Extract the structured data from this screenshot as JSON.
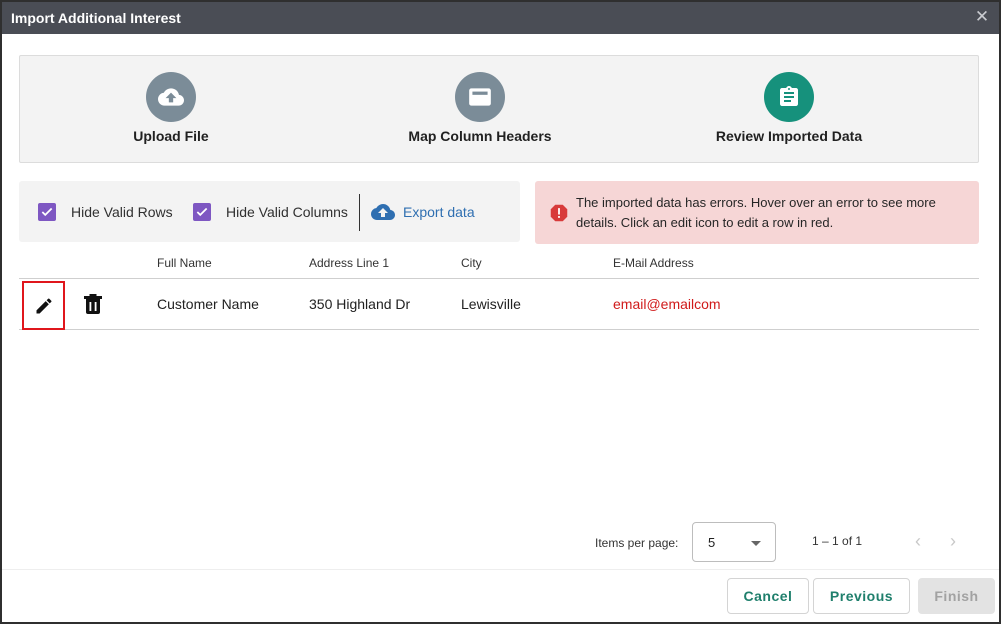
{
  "dialog": {
    "title": "Import Additional Interest",
    "close_glyph": "✕"
  },
  "stepper": {
    "steps": [
      {
        "label": "Upload File",
        "icon": "cloud-upload-icon",
        "state": "done"
      },
      {
        "label": "Map Column Headers",
        "icon": "column-headers-icon",
        "state": "done"
      },
      {
        "label": "Review Imported Data",
        "icon": "clipboard-icon",
        "state": "active"
      }
    ],
    "colors": {
      "done": "#7b8c98",
      "active": "#16917c"
    }
  },
  "toolbar": {
    "hide_valid_rows": {
      "label": "Hide Valid Rows",
      "checked": true
    },
    "hide_valid_columns": {
      "label": "Hide Valid Columns",
      "checked": true
    },
    "export_label": "Export data"
  },
  "alert": {
    "icon": "error-octagon-icon",
    "text": "The imported data has errors. Hover over an error to see more details. Click an edit icon to edit a row in red."
  },
  "table": {
    "columns": [
      "Full Name",
      "Address Line 1",
      "City",
      "E-Mail Address"
    ],
    "rows": [
      {
        "full_name": "Customer Name",
        "address_line_1": "350 Highland Dr",
        "city": "Lewisville",
        "email": "email@emailcom",
        "email_error": true
      }
    ]
  },
  "paginator": {
    "items_per_page_label": "Items per page:",
    "items_per_page": "5",
    "range": "1 – 1 of 1",
    "prev_glyph": "‹",
    "next_glyph": "›"
  },
  "footer": {
    "cancel": "Cancel",
    "previous": "Previous",
    "finish": "Finish"
  },
  "colors": {
    "accent": "#16917c",
    "error": "#d01b1b",
    "checkbox": "#7e57c2",
    "link": "#2f6fb1",
    "titlebar": "#4a4d55"
  }
}
